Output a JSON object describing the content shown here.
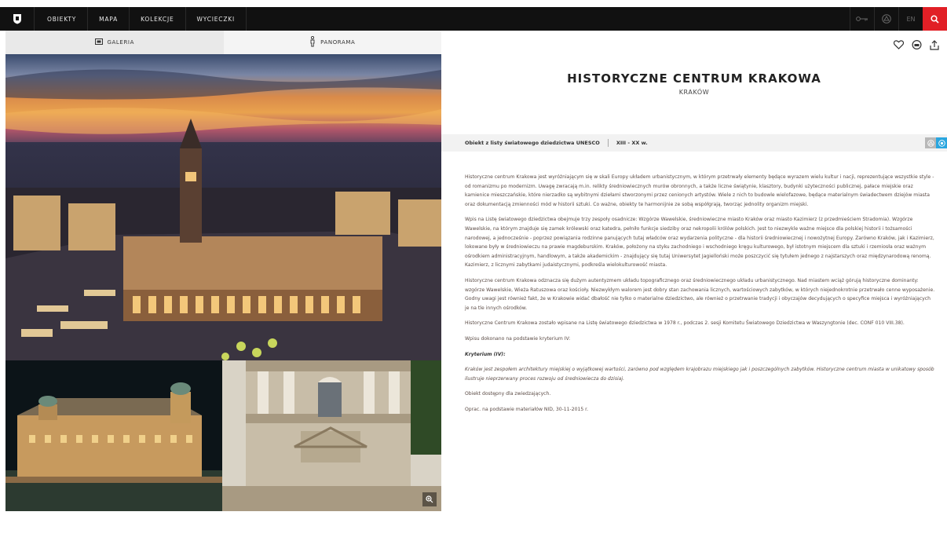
{
  "nav": {
    "items": [
      "OBIEKTY",
      "MAPA",
      "KOLEKCJE",
      "WYCIECZKI"
    ],
    "lang": "EN"
  },
  "gallery": {
    "tabs": [
      "GALERIA",
      "PANORAMA"
    ]
  },
  "object": {
    "title": "HISTORYCZNE CENTRUM KRAKOWA",
    "city": "KRAKÓW",
    "meta_status": "Obiekt z listy światowego dziedzictwa UNESCO",
    "meta_period": "XIII - XX w.",
    "paragraphs": [
      "Historyczne centrum Krakowa jest wyróżniającym się w skali Europy układem urbanistycznym, w którym przetrwały elementy będące wyrazem wielu kultur i nacji, reprezentujące wszystkie style - od romanizmu po modernizm. Uwagę zwracają m.in. relikty średniowiecznych murów obronnych, a także liczne świątynie, klasztory, budynki użyteczności publicznej, pałace miejskie oraz kamienice mieszczańskie, które nierzadko są wybitnymi dziełami stworzonymi przez cenionych artystów. Wiele z nich to budowle wielofazowe, będące materialnym świadectwem dziejów miasta oraz dokumentacją zmienności mód w historii sztuki. Co ważne, obiekty te harmonijnie ze sobą współgrają, tworząc jednolity organizm miejski.",
      "Wpis na Listę światowego dziedzictwa obejmuje trzy zespoły osadnicze: Wzgórze Wawelskie, średniowieczne miasto Kraków oraz miasto Kazimierz (z przedmieściem Stradomia). Wzgórze Wawelskie, na którym znajduje się zamek królewski oraz katedra, pełniło funkcje siedziby oraz nekropolii królów polskich. Jest to niezwykle ważne miejsce dla polskiej historii i tożsamości narodowej, a jednocześnie - poprzez powiązania rodzinne panujących tutaj władców oraz wydarzenia polityczne - dla historii średniowiecznej i nowożytnej Europy. Zarówno Kraków, jak i Kazimierz, lokowane były w średniowieczu na prawie magdeburskim. Kraków, położony na styku zachodniego i wschodniego kręgu kulturowego, był istotnym miejscem dla sztuki i rzemiosła oraz ważnym ośrodkiem administracyjnym, handlowym, a także akademickim - znajdujący się tutaj Uniwersytet Jagielloński może poszczycić się tytułem jednego z najstarszych oraz międzynarodową renomą. Kazimierz, z licznymi zabytkami judaistycznymi, podkreśla wielokulturowość miasta.",
      "Historyczne centrum Krakowa odznacza się dużym autentyzmem układu topograficznego oraz średniowiecznego układu urbanistycznego. Nad miastem wciąż górują historyczne dominanty: wzgórze Wawelskie, Wieża Ratuszowa oraz kościoły. Niezwykłym walorem jest dobry stan zachowania licznych, wartościowych zabytków, w których niejednokrotnie przetrwało cenne wyposażenie. Godny uwagi jest również fakt, że w Krakowie widać dbałość nie tylko o materialne dziedzictwo, ale również o przetrwanie tradycji i obyczajów decydujących o specyfice miejsca i wyróżniających je na tle innych ośrodków.",
      "Historyczne Centrum Krakowa zostało wpisane na Listę światowego dziedzictwa w 1978 r., podczas 2. sesji Komitetu Światowego Dziedzictwa w Waszyngtonie (dec. CONF 010 VIII.38).",
      "Wpisu dokonano na podstawie kryterium IV:"
    ],
    "criterion_heading": "Kryterium (IV):",
    "criterion_text": "Kraków jest zespołem architektury miejskiej o wyjątkowej wartości, zarówno pod względem krajobrazu miejskiego jak i poszczególnych zabytków. Historyczne centrum miasta w unikatowy sposób ilustruje nieprzerwany proces rozwoju od średniowiecza do dzisiaj.",
    "availability": "Obiekt dostępny dla zwiedzających.",
    "source": "Oprac. na podstawie materiałów NID, 30-11-2015 r."
  },
  "colors": {
    "topbar": "#111111",
    "search_accent": "#e11f26",
    "meta_icon_grey": "#b8b8b8",
    "meta_icon_blue": "#2aa6df"
  }
}
